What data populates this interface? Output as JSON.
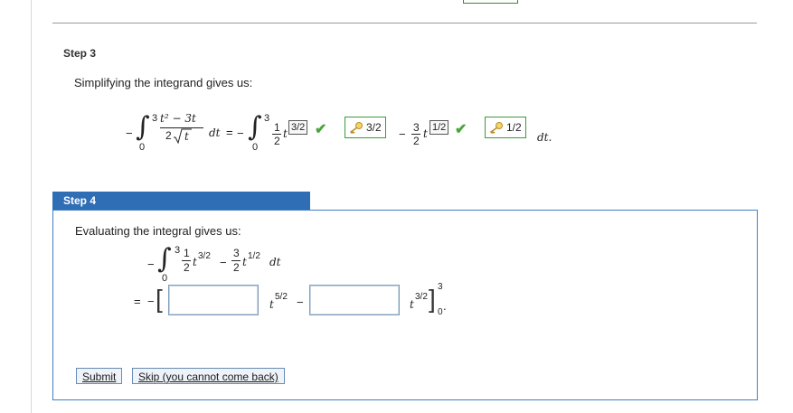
{
  "step3": {
    "title": "Step 3",
    "text": "Simplifying the integrand gives us:",
    "lhs": {
      "minus": "−",
      "integral_sign": "∫",
      "upper": "3",
      "lower": "0",
      "numerator": "t² − 3t",
      "denominator_coef": "2",
      "denominator_var": "t",
      "differential": "dt"
    },
    "equals": "=",
    "rhs": {
      "minus": "−",
      "integral_sign": "∫",
      "upper": "3",
      "lower": "0",
      "term1_num": "1",
      "term1_den": "2",
      "term1_var": "t",
      "term1_exponent_answer": "3/2",
      "term1_key_answer": "3/2",
      "operator": "−",
      "term2_num": "3",
      "term2_den": "2",
      "term2_var": "t",
      "term2_exponent_answer": "1/2",
      "term2_key_answer": "1/2",
      "differential": "dt."
    }
  },
  "step4": {
    "title": "Step 4",
    "text": "Evaluating the integral gives us:",
    "integral": {
      "minus": "−",
      "integral_sign": "∫",
      "upper": "3",
      "lower": "0",
      "term1_num": "1",
      "term1_den": "2",
      "term1_power": "t",
      "term1_exp": "3/2",
      "operator": "−",
      "term2_num": "3",
      "term2_den": "2",
      "term2_power": "t",
      "term2_exp": "1/2",
      "differential": "dt"
    },
    "result": {
      "equals": "=",
      "minus": "−",
      "bracket_open": "[",
      "input1_value": "",
      "power1_base": "t",
      "power1_exp": "5/2",
      "operator": "−",
      "input2_value": "",
      "power2_base": "t",
      "power2_exp": "3/2",
      "bracket_close": "]",
      "upper": "3",
      "lower": "0",
      "period": "."
    },
    "buttons": {
      "submit": "Submit",
      "skip": "Skip (you cannot come back)"
    }
  },
  "colors": {
    "header_blue": "#2f6db5",
    "panel_border": "#3f7fc6",
    "check_green": "#49a63b",
    "answer_box_border": "#3a9a3a"
  },
  "icons": [
    "check-icon",
    "key-icon"
  ]
}
